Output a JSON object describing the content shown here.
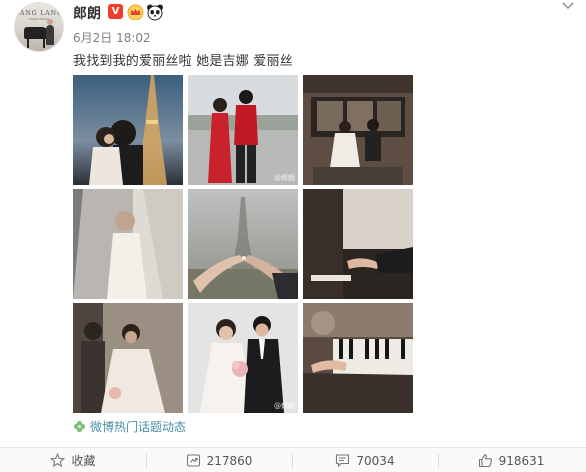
{
  "post": {
    "author": "郎朗",
    "verified_badge": "V",
    "timestamp": "6月2日 18:02",
    "text": "我找到我的爱丽丝啦 她是吉娜 爱丽丝",
    "topic_link": "微博热门话题动态",
    "photo_watermark": "@郎朗"
  },
  "avatar": {
    "brand": "LANG LANG",
    "subtext": "PIANO MUSIC"
  },
  "photos": [
    {
      "name": "photo-eiffel-night-couple"
    },
    {
      "name": "photo-red-qipao-couple"
    },
    {
      "name": "photo-paris-cafe-couple"
    },
    {
      "name": "photo-bride-veil"
    },
    {
      "name": "photo-hands-ring-eiffel"
    },
    {
      "name": "photo-piano-hands-window"
    },
    {
      "name": "photo-bride-groom-lace"
    },
    {
      "name": "photo-wedding-portrait"
    },
    {
      "name": "photo-piano-keys-hands"
    }
  ],
  "actions": {
    "favorite": {
      "label": "收藏",
      "icon": "star-icon"
    },
    "repost": {
      "count": "217860",
      "icon": "repost-icon"
    },
    "comment": {
      "count": "70034",
      "icon": "comment-icon"
    },
    "like": {
      "count": "918631",
      "icon": "thumbs-up-icon"
    }
  },
  "colors": {
    "link": "#4a90a4",
    "badge_red": "#f23c2c",
    "muted_text": "#808080"
  }
}
